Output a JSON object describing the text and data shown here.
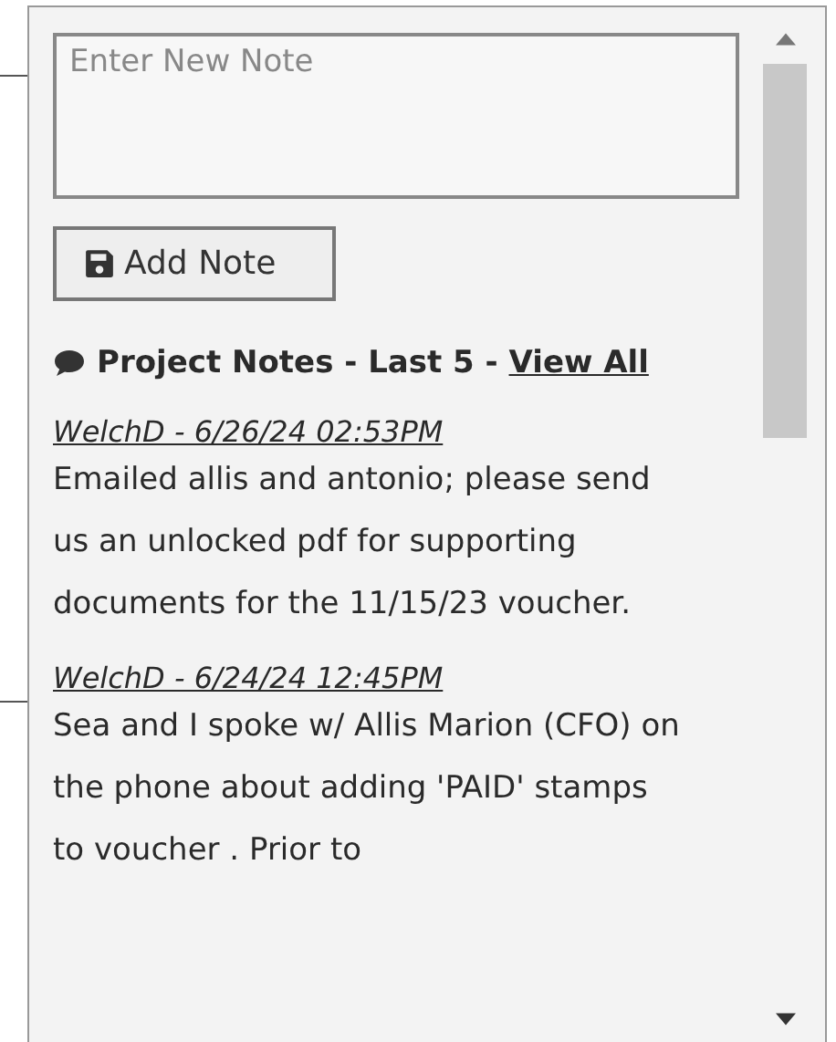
{
  "note_input": {
    "placeholder": "Enter New Note"
  },
  "add_button": {
    "label": "Add Note"
  },
  "notes_heading": {
    "title": "Project Notes - Last 5 - ",
    "link": "View All"
  },
  "notes": [
    {
      "header": "WelchD - 6/26/24 02:53PM",
      "text": "Emailed allis and antonio; please send us an unlocked pdf for supporting documents for the 11/15/23 voucher."
    },
    {
      "header": "WelchD - 6/24/24 12:45PM",
      "text": "Sea and I spoke w/ Allis Marion (CFO) on the phone about adding 'PAID' stamps to voucher . Prior to"
    }
  ]
}
